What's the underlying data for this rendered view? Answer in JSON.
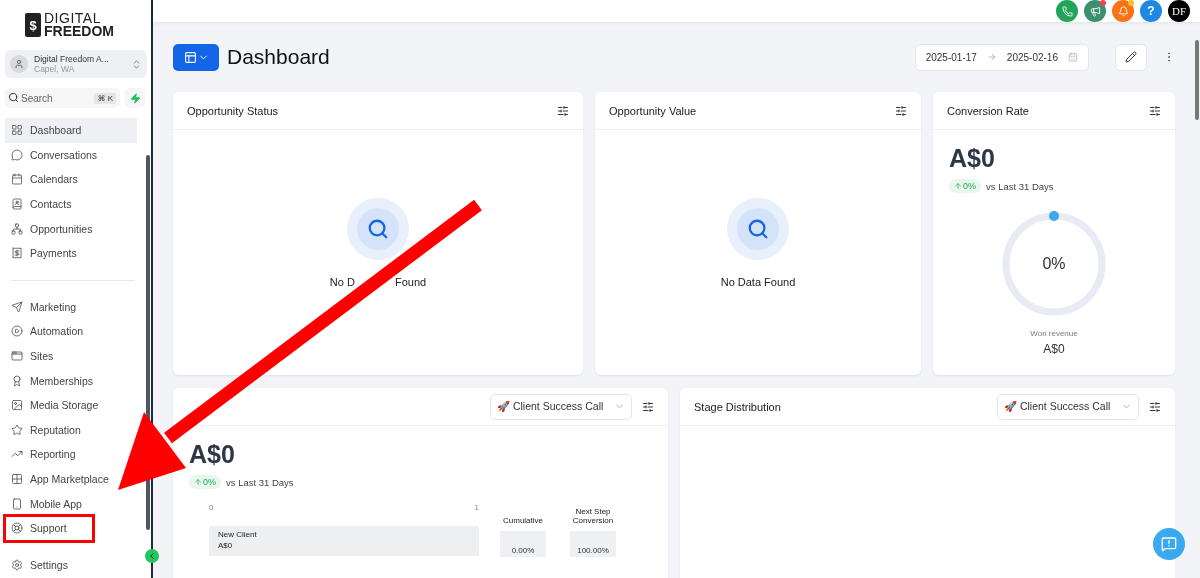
{
  "logo": {
    "mark": "$",
    "line1": "DIGITAL",
    "line2": "FREEDOM"
  },
  "account": {
    "name": "Digital Freedom A...",
    "location": "Capel, WA"
  },
  "search": {
    "placeholder": "Search",
    "shortcut": "⌘ K"
  },
  "nav_main": [
    {
      "label": "Dashboard",
      "selected": true
    },
    {
      "label": "Conversations",
      "selected": false
    },
    {
      "label": "Calendars",
      "selected": false
    },
    {
      "label": "Contacts",
      "selected": false
    },
    {
      "label": "Opportunities",
      "selected": false
    },
    {
      "label": "Payments",
      "selected": false
    }
  ],
  "nav_tools": [
    {
      "label": "Marketing",
      "selected": false
    },
    {
      "label": "Automation",
      "selected": false
    },
    {
      "label": "Sites",
      "selected": false
    },
    {
      "label": "Memberships",
      "selected": false
    },
    {
      "label": "Media Storage",
      "selected": false
    },
    {
      "label": "Reputation",
      "selected": false
    },
    {
      "label": "Reporting",
      "selected": false
    },
    {
      "label": "App Marketplace",
      "selected": false
    },
    {
      "label": "Mobile App",
      "selected": false
    },
    {
      "label": "Support",
      "selected": false,
      "highlighted": true
    }
  ],
  "settings": {
    "label": "Settings"
  },
  "topbar": {
    "help_label": "?",
    "avatar": "DF"
  },
  "page": {
    "title": "Dashboard",
    "date_from": "2025-01-17",
    "date_to": "2025-02-16"
  },
  "cards": [
    {
      "title": "Opportunity Status",
      "empty": [
        "No D",
        "Found"
      ]
    },
    {
      "title": "Opportunity Value",
      "empty": [
        "No Data Found"
      ]
    }
  ],
  "conversion": {
    "title": "Conversion Rate",
    "value": "A$0",
    "change": "0%",
    "compare": "vs Last 31 Days",
    "center": "0%",
    "caption": "Won revenue",
    "caption_value": "A$0"
  },
  "funnel": {
    "pipeline": "🚀 Client Success Call",
    "value": "A$0",
    "change": "0%",
    "compare": "vs Last 31 Days",
    "axis_min": "0",
    "axis_max": "1",
    "stage": "New Client",
    "stage_value": "A$0",
    "cumulative_label": "Cumulative",
    "cumulative": "0.00%",
    "next_label": "Next Step Conversion",
    "next": "100.00%"
  },
  "stage_distribution": {
    "title": "Stage Distribution",
    "pipeline": "🚀 Client Success Call"
  }
}
